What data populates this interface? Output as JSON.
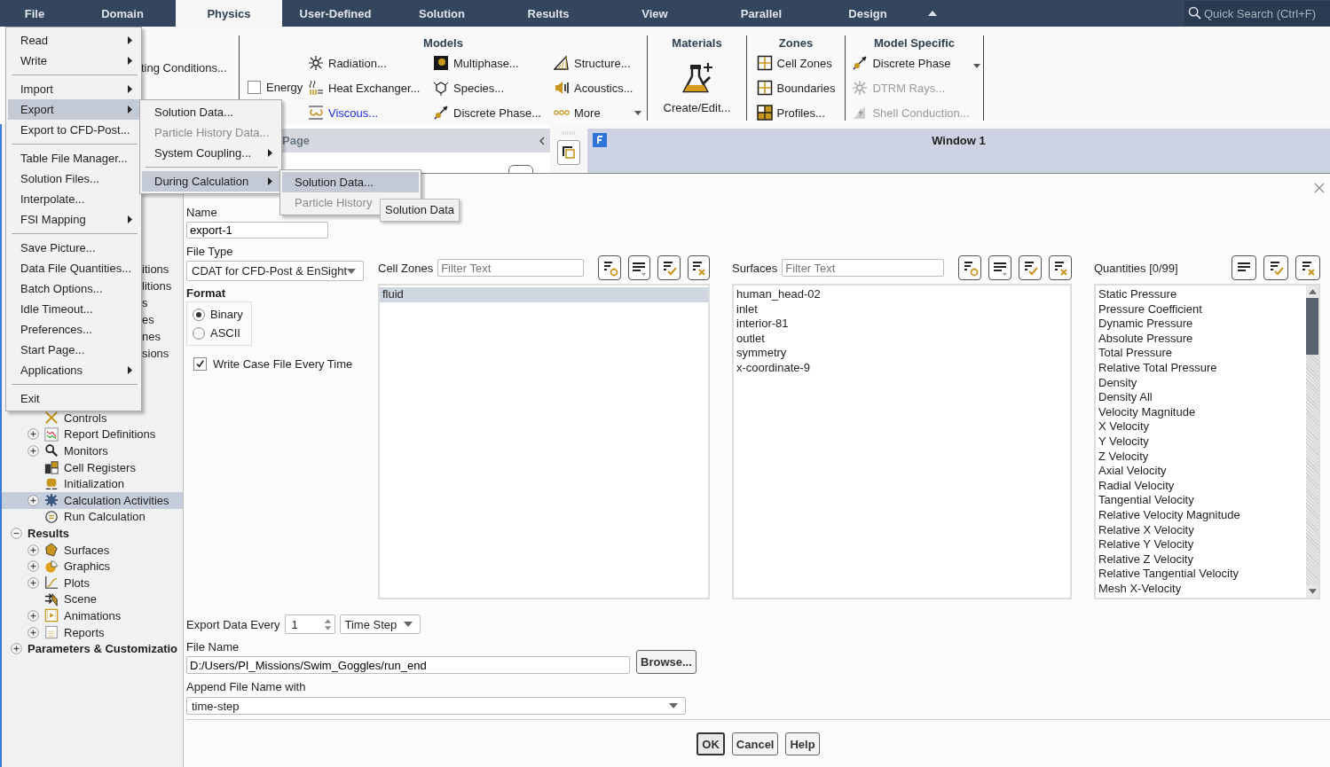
{
  "menu_bar": {
    "tabs": [
      {
        "label": "File",
        "selected": false
      },
      {
        "label": "Domain",
        "selected": false
      },
      {
        "label": "Physics",
        "selected": true
      },
      {
        "label": "User-Defined",
        "selected": false
      },
      {
        "label": "Solution",
        "selected": false
      },
      {
        "label": "Results",
        "selected": false
      },
      {
        "label": "View",
        "selected": false
      },
      {
        "label": "Parallel",
        "selected": false
      },
      {
        "label": "Design",
        "selected": false
      }
    ],
    "search": {
      "placeholder": "Quick Search (Ctrl+F)"
    }
  },
  "ribbon": {
    "partial_label": "ting Conditions...",
    "models": {
      "title": "Models",
      "energy": {
        "label": "Energy",
        "checked": false
      },
      "items": [
        {
          "label": "Radiation...",
          "active": false,
          "kind": "button"
        },
        {
          "label": "Heat Exchanger...",
          "active": false,
          "kind": "button"
        },
        {
          "label": "Viscous...",
          "active": true,
          "kind": "button"
        },
        {
          "label": "Multiphase...",
          "active": false,
          "kind": "button"
        },
        {
          "label": "Species...",
          "active": false,
          "kind": "button"
        },
        {
          "label": "Discrete Phase...",
          "active": false,
          "kind": "button"
        },
        {
          "label": "Structure...",
          "active": false,
          "kind": "button"
        },
        {
          "label": "Acoustics...",
          "active": false,
          "kind": "button"
        },
        {
          "label": "More",
          "active": false,
          "kind": "dropdown"
        }
      ]
    },
    "materials": {
      "title": "Materials",
      "button": "Create/Edit..."
    },
    "zones": {
      "title": "Zones",
      "items": [
        "Cell Zones",
        "Boundaries",
        "Profiles..."
      ]
    },
    "model_specific": {
      "title": "Model Specific",
      "items": [
        {
          "label": "Discrete Phase",
          "disabled": false
        },
        {
          "label": "DTRM Rays...",
          "disabled": true
        },
        {
          "label": "Shell Conduction...",
          "disabled": true
        }
      ]
    }
  },
  "tree": {
    "partial_rows": [
      "itions",
      "litions",
      "s",
      "es",
      "nes",
      "sions"
    ],
    "nodes": [
      {
        "children": [
          {
            "label": "Controls",
            "selected": false
          },
          {
            "label": "Report Definitions",
            "expanded": false,
            "selected": false
          },
          {
            "label": "Monitors",
            "expanded": false,
            "selected": false
          },
          {
            "label": "Cell Registers",
            "selected": false
          },
          {
            "label": "Initialization",
            "selected": false
          },
          {
            "label": "Calculation Activities",
            "expanded": false,
            "selected": true
          },
          {
            "label": "Run Calculation",
            "selected": false
          }
        ]
      },
      {
        "label": "Results",
        "expanded": true,
        "selected": false,
        "children": [
          {
            "label": "Surfaces",
            "expanded": false,
            "selected": false
          },
          {
            "label": "Graphics",
            "expanded": false,
            "selected": false
          },
          {
            "label": "Plots",
            "expanded": false,
            "selected": false
          },
          {
            "label": "Scene",
            "selected": false
          },
          {
            "label": "Animations",
            "expanded": false,
            "selected": false
          },
          {
            "label": "Reports",
            "expanded": false,
            "selected": false
          }
        ]
      },
      {
        "label": "Parameters & Customizatio",
        "expanded": false,
        "selected": false
      }
    ]
  },
  "task_page": {
    "title": "Page"
  },
  "graphics": {
    "title": "Window 1"
  },
  "dialog": {
    "name": {
      "label": "Name",
      "value": "export-1"
    },
    "file_type": {
      "label": "File Type",
      "value": "CDAT for CFD-Post & EnSight"
    },
    "format": {
      "label": "Format",
      "options": [
        {
          "label": "Binary",
          "selected": true
        },
        {
          "label": "ASCII",
          "selected": false
        }
      ]
    },
    "write_case": {
      "label": "Write Case File Every Time",
      "checked": true
    },
    "lists": [
      {
        "label": "Cell Zones",
        "kind": "filtered",
        "placeholder": "Filter Text",
        "items": [
          {
            "label": "fluid",
            "selected": true
          }
        ]
      },
      {
        "label": "Surfaces",
        "kind": "filtered",
        "placeholder": "Filter Text",
        "items": [
          {
            "label": "human_head-02",
            "selected": false
          },
          {
            "label": "inlet",
            "selected": false
          },
          {
            "label": "interior-81",
            "selected": false
          },
          {
            "label": "outlet",
            "selected": false
          },
          {
            "label": "symmetry",
            "selected": false
          },
          {
            "label": "x-coordinate-9",
            "selected": false
          }
        ]
      },
      {
        "label": "Quantities [0/99]",
        "kind": "counted",
        "items": [
          {
            "label": "Static Pressure",
            "selected": false
          },
          {
            "label": "Pressure Coefficient",
            "selected": false
          },
          {
            "label": "Dynamic Pressure",
            "selected": false
          },
          {
            "label": "Absolute Pressure",
            "selected": false
          },
          {
            "label": "Total Pressure",
            "selected": false
          },
          {
            "label": "Relative Total Pressure",
            "selected": false
          },
          {
            "label": "Density",
            "selected": false
          },
          {
            "label": "Density All",
            "selected": false
          },
          {
            "label": "Velocity Magnitude",
            "selected": false
          },
          {
            "label": "X Velocity",
            "selected": false
          },
          {
            "label": "Y Velocity",
            "selected": false
          },
          {
            "label": "Z Velocity",
            "selected": false
          },
          {
            "label": "Axial Velocity",
            "selected": false
          },
          {
            "label": "Radial Velocity",
            "selected": false
          },
          {
            "label": "Tangential Velocity",
            "selected": false
          },
          {
            "label": "Relative Velocity Magnitude",
            "selected": false
          },
          {
            "label": "Relative X Velocity",
            "selected": false
          },
          {
            "label": "Relative Y Velocity",
            "selected": false
          },
          {
            "label": "Relative Z Velocity",
            "selected": false
          },
          {
            "label": "Relative Tangential Velocity",
            "selected": false
          },
          {
            "label": "Mesh X-Velocity",
            "selected": false
          }
        ]
      }
    ],
    "export_every": {
      "label": "Export Data Every",
      "value": "1",
      "unit": "Time Step"
    },
    "file_name": {
      "label": "File Name",
      "value": "D:/Users/PI_Missions/Swim_Goggles/run_end",
      "browse": "Browse..."
    },
    "append": {
      "label": "Append File Name with",
      "value": "time-step"
    },
    "buttons": [
      {
        "label": "OK",
        "kind": "default"
      },
      {
        "label": "Cancel",
        "kind": "normal"
      },
      {
        "label": "Help",
        "kind": "normal"
      }
    ]
  },
  "file_menu": {
    "items": [
      {
        "kind": "item",
        "label": "Read",
        "submenu": true,
        "selected": false
      },
      {
        "kind": "item",
        "label": "Write",
        "submenu": true,
        "selected": false
      },
      {
        "kind": "separator"
      },
      {
        "kind": "item",
        "label": "Import",
        "submenu": true,
        "selected": false
      },
      {
        "kind": "item",
        "label": "Export",
        "submenu": true,
        "selected": true
      },
      {
        "kind": "item",
        "label": "Export to CFD-Post...",
        "submenu": false,
        "selected": false
      },
      {
        "kind": "separator"
      },
      {
        "kind": "item",
        "label": "Table File Manager...",
        "submenu": false,
        "selected": false
      },
      {
        "kind": "item",
        "label": "Solution Files...",
        "submenu": false,
        "selected": false
      },
      {
        "kind": "item",
        "label": "Interpolate...",
        "submenu": false,
        "selected": false
      },
      {
        "kind": "item",
        "label": "FSI Mapping",
        "submenu": true,
        "selected": false
      },
      {
        "kind": "separator"
      },
      {
        "kind": "item",
        "label": "Save Picture...",
        "submenu": false,
        "selected": false
      },
      {
        "kind": "item",
        "label": "Data File Quantities...",
        "submenu": false,
        "selected": false
      },
      {
        "kind": "item",
        "label": "Batch Options...",
        "submenu": false,
        "selected": false
      },
      {
        "kind": "item",
        "label": "Idle Timeout...",
        "submenu": false,
        "selected": false
      },
      {
        "kind": "item",
        "label": "Preferences...",
        "submenu": false,
        "selected": false
      },
      {
        "kind": "item",
        "label": "Start Page...",
        "submenu": false,
        "selected": false
      },
      {
        "kind": "item",
        "label": "Applications",
        "submenu": true,
        "selected": false
      },
      {
        "kind": "separator"
      },
      {
        "kind": "item",
        "label": "Exit",
        "submenu": false,
        "selected": false
      }
    ]
  },
  "export_menu": {
    "items": [
      {
        "kind": "item",
        "label": "Solution Data...",
        "submenu": false,
        "selected": false,
        "disabled": false
      },
      {
        "kind": "item",
        "label": "Particle History Data...",
        "submenu": false,
        "selected": false,
        "disabled": true
      },
      {
        "kind": "item",
        "label": "System Coupling...",
        "submenu": true,
        "selected": false,
        "disabled": false
      },
      {
        "kind": "separator"
      },
      {
        "kind": "item",
        "label": "During Calculation",
        "submenu": true,
        "selected": true,
        "disabled": false
      }
    ]
  },
  "during_menu": {
    "items": [
      {
        "kind": "item",
        "label": "Solution Data...",
        "submenu": false,
        "selected": true,
        "disabled": false
      },
      {
        "kind": "item",
        "label": "Particle History",
        "submenu": false,
        "selected": false,
        "disabled": true
      }
    ]
  },
  "tooltip": "Solution Data"
}
